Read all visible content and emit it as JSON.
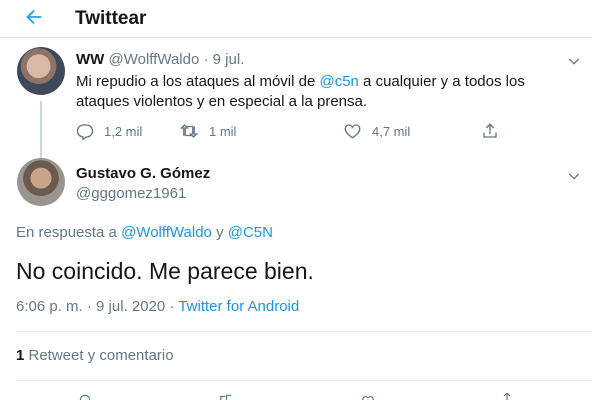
{
  "header": {
    "title": "Twittear"
  },
  "parent_tweet": {
    "name": "WW",
    "handle": "@WolffWaldo",
    "separator": "·",
    "date": "9 jul.",
    "text_before_mention": "Mi repudio a los ataques al móvil de ",
    "mention": "@c5n",
    "text_after_mention": " a cualquier y a todos los ataques violentos y en especial a la prensa.",
    "actions": {
      "replies": "1,2 mil",
      "retweets": "1 mil",
      "likes": "4,7 mil"
    }
  },
  "focal_tweet": {
    "name": "Gustavo G. Gómez",
    "handle": "@gggomez1961",
    "reply_prefix": "En respuesta a ",
    "reply_mention_1": "@WolffWaldo",
    "reply_conjunction": " y ",
    "reply_mention_2": "@C5N",
    "text": "No coincido. Me parece bien.",
    "time": "6:06 p. m.",
    "date": "9 jul. 2020",
    "meta_separator_1": " · ",
    "meta_separator_2": " · ",
    "source": "Twitter for Android",
    "retweet_count": "1",
    "retweet_label": " Retweet y comentario"
  },
  "colors": {
    "accent": "#1da1f2",
    "text": "#14171a",
    "muted": "#657786",
    "border": "#e6ecf0"
  },
  "icons": {
    "back": "back-arrow-icon",
    "caret": "chevron-down-icon",
    "reply": "reply-icon",
    "retweet": "retweet-icon",
    "like": "heart-icon",
    "share": "share-icon"
  }
}
